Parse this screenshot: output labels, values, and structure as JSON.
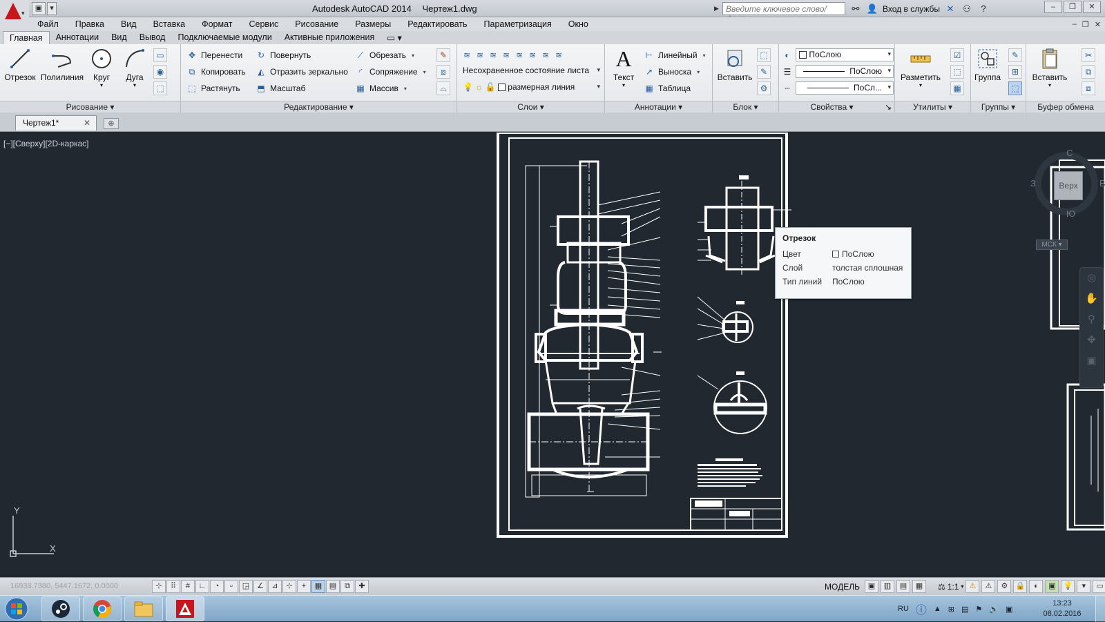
{
  "window": {
    "app_title": "Autodesk AutoCAD 2014",
    "file_title": "Чертеж1.dwg",
    "search_placeholder": "Введите ключевое слово/фразу",
    "login_label": "Вход в службы"
  },
  "menu": [
    "Файл",
    "Правка",
    "Вид",
    "Вставка",
    "Формат",
    "Сервис",
    "Рисование",
    "Размеры",
    "Редактировать",
    "Параметризация",
    "Окно"
  ],
  "ribbon_tabs": [
    "Главная",
    "Аннотации",
    "Вид",
    "Вывод",
    "Подключаемые модули",
    "Активные приложения"
  ],
  "ribbon": {
    "draw": {
      "title": "Рисование",
      "line": "Отрезок",
      "polyline": "Полилиния",
      "circle": "Круг",
      "arc": "Дуга"
    },
    "modify": {
      "title": "Редактирование",
      "move": "Перенести",
      "rotate": "Повернуть",
      "trim": "Обрезать",
      "copy": "Копировать",
      "mirror": "Отразить зеркально",
      "fillet": "Сопряжение",
      "stretch": "Растянуть",
      "scale": "Масштаб",
      "array": "Массив"
    },
    "layers": {
      "title": "Слои",
      "state": "Несохраненное состояние листа",
      "current_layer": "размерная линия"
    },
    "annotation": {
      "title": "Аннотации",
      "text": "Текст",
      "linear": "Линейный",
      "leader": "Выноска",
      "table": "Таблица"
    },
    "block": {
      "title": "Блок",
      "insert": "Вставить"
    },
    "properties": {
      "title": "Свойства",
      "color": "ПоСлою",
      "lineweight": "ПоСлою",
      "linetype": "ПоСл..."
    },
    "utilities": {
      "title": "Утилиты",
      "measure": "Разметить"
    },
    "groups": {
      "title": "Группы",
      "group": "Группа"
    },
    "clipboard": {
      "title": "Буфер обмена",
      "paste": "Вставить"
    }
  },
  "doc_tab": "Чертеж1*",
  "viewport_label": "[−][Сверху][2D-каркас]",
  "viewcube": {
    "face": "Верх",
    "north": "С",
    "south": "Ю",
    "west": "З",
    "east": "В",
    "ucs": "МСК"
  },
  "tooltip": {
    "title": "Отрезок",
    "rows": [
      {
        "key": "Цвет",
        "value": "ПоСлою"
      },
      {
        "key": "Слой",
        "value": "толстая сплошная"
      },
      {
        "key": "Тип линий",
        "value": "ПоСлою"
      }
    ]
  },
  "ucs": {
    "x": "X",
    "y": "Y"
  },
  "status": {
    "coords": "16938.7380, 5447.1672, 0.0000",
    "model": "МОДЕЛЬ",
    "scale": "1:1"
  },
  "taskbar": {
    "lang": "RU",
    "time": "13:23",
    "date": "08.02.2016"
  }
}
